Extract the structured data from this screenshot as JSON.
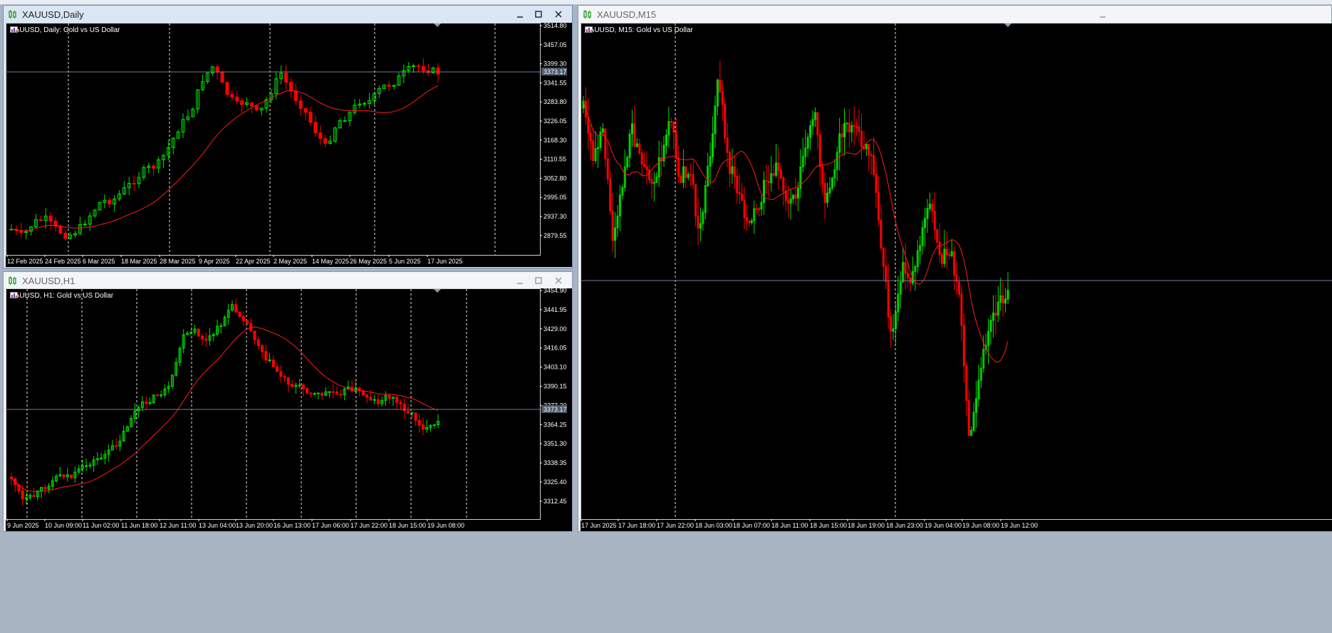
{
  "colors": {
    "bull": "#00e000",
    "bear": "#ff0000",
    "ma": "#ff1a1a",
    "bid_line": "#6e7f94",
    "grid": "#ffffff",
    "background": "#000000"
  },
  "icons": {
    "window_icon": "candles-icon",
    "chart_type_icon": "calendar-table-icon",
    "symbol_icon": "bar-chart-icon"
  },
  "controls": {
    "minimize": "minimize-icon",
    "maximize": "maximize-icon",
    "close": "close-icon"
  },
  "windows": {
    "daily": {
      "title": "XAUUSD,Daily",
      "label": "XAUUSD, Daily:  Gold vs US Dollar",
      "bid": "3373.17",
      "y_ticks": [
        "3514.80",
        "3457.05",
        "3399.30",
        "3341.55",
        "3283.80",
        "3226.05",
        "3168.30",
        "3110.55",
        "3052.80",
        "2995.05",
        "2937.30",
        "2879.55"
      ],
      "x_ticks": [
        "12 Feb 2025",
        "24 Feb 2025",
        "6 Mar 2025",
        "18 Mar 2025",
        "28 Mar 2025",
        "9 Apr 2025",
        "22 Apr 2025",
        "2 May 2025",
        "14 May 2025",
        "26 May 2025",
        "5 Jun 2025",
        "17 Jun 2025"
      ]
    },
    "h1": {
      "title": "XAUUSD,H1",
      "label": "XAUUSD, H1:  Gold vs US Dollar",
      "bid": "3373.17",
      "y_ticks": [
        "3454.90",
        "3441.95",
        "3429.00",
        "3416.05",
        "3403.10",
        "3390.15",
        "3377.20",
        "3364.25",
        "3351.30",
        "3338.35",
        "3325.40",
        "3312.45"
      ],
      "x_ticks": [
        "9 Jun 2025",
        "10 Jun 09:00",
        "11 Jun 02:00",
        "11 Jun 18:00",
        "12 Jun 11:00",
        "13 Jun 04:00",
        "13 Jun 20:00",
        "16 Jun 13:00",
        "17 Jun 06:00",
        "17 Jun 22:00",
        "18 Jun 15:00",
        "19 Jun 08:00"
      ]
    },
    "m15": {
      "title": "XAUUSD,M15",
      "label": "XAUUSD, M15:  Gold vs US Dollar",
      "x_ticks": [
        "17 Jun 2025",
        "17 Jun 18:00",
        "17 Jun 22:00",
        "18 Jun 03:00",
        "18 Jun 07:00",
        "18 Jun 11:00",
        "18 Jun 15:00",
        "18 Jun 19:00",
        "18 Jun 23:00",
        "19 Jun 04:00",
        "19 Jun 08:00",
        "19 Jun 12:00"
      ]
    }
  }
}
